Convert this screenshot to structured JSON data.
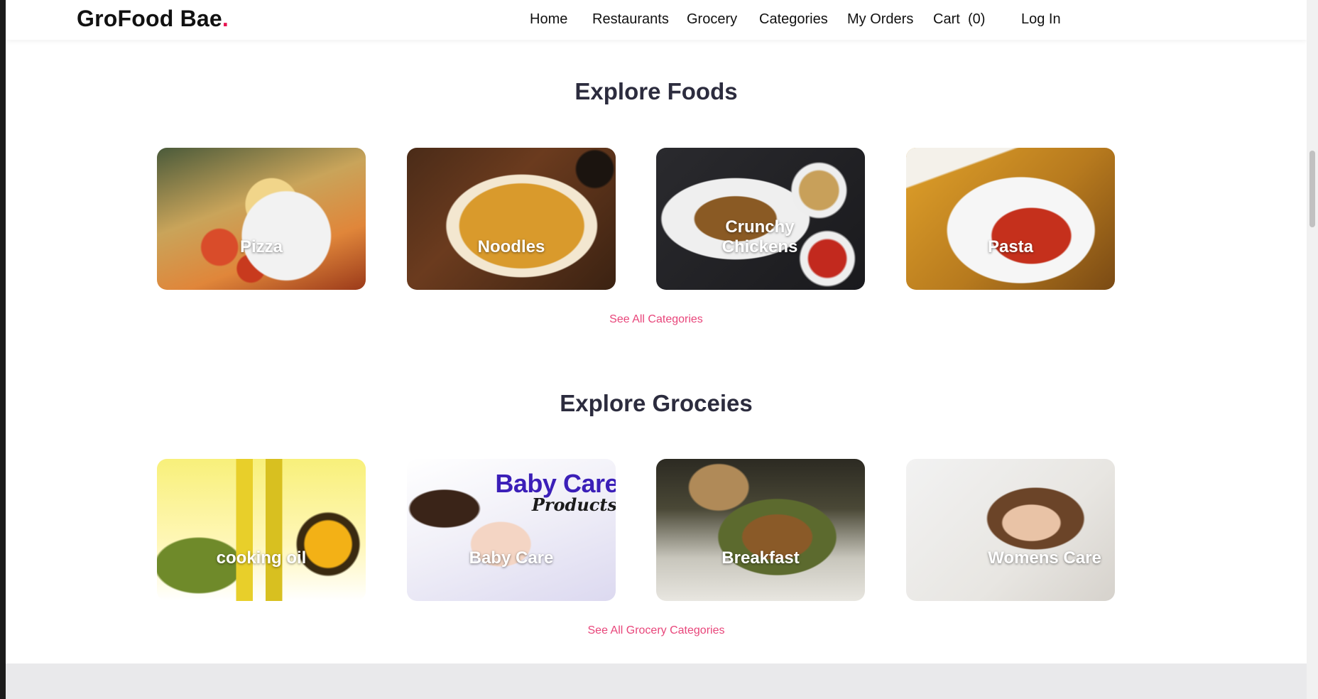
{
  "header": {
    "brand_name": "GroFood Bae",
    "brand_dot": ".",
    "nav": [
      {
        "label": "Home"
      },
      {
        "label": "Restaurants"
      },
      {
        "label": "Grocery"
      },
      {
        "label": "Categories"
      },
      {
        "label": "My Orders"
      },
      {
        "label": "Cart"
      },
      {
        "label": "(0)"
      },
      {
        "label": "Log In"
      }
    ]
  },
  "foods": {
    "title": "Explore Foods",
    "items": [
      {
        "label": "Pizza"
      },
      {
        "label": "Noodles"
      },
      {
        "label": "Crunchy Chickens"
      },
      {
        "label": "Pasta"
      }
    ],
    "see_all": "See All Categories"
  },
  "groceries": {
    "title": "Explore Groceies",
    "items": [
      {
        "label": "cooking oil"
      },
      {
        "label": "Baby Care",
        "image_text": "Baby Care",
        "image_subtext": "Products"
      },
      {
        "label": "Breakfast"
      },
      {
        "label": "Womens Care"
      }
    ],
    "see_all": "See All Grocery Categories"
  },
  "colors": {
    "accent": "#e8124f",
    "link": "#e8457a",
    "heading": "#2c2c3e"
  }
}
